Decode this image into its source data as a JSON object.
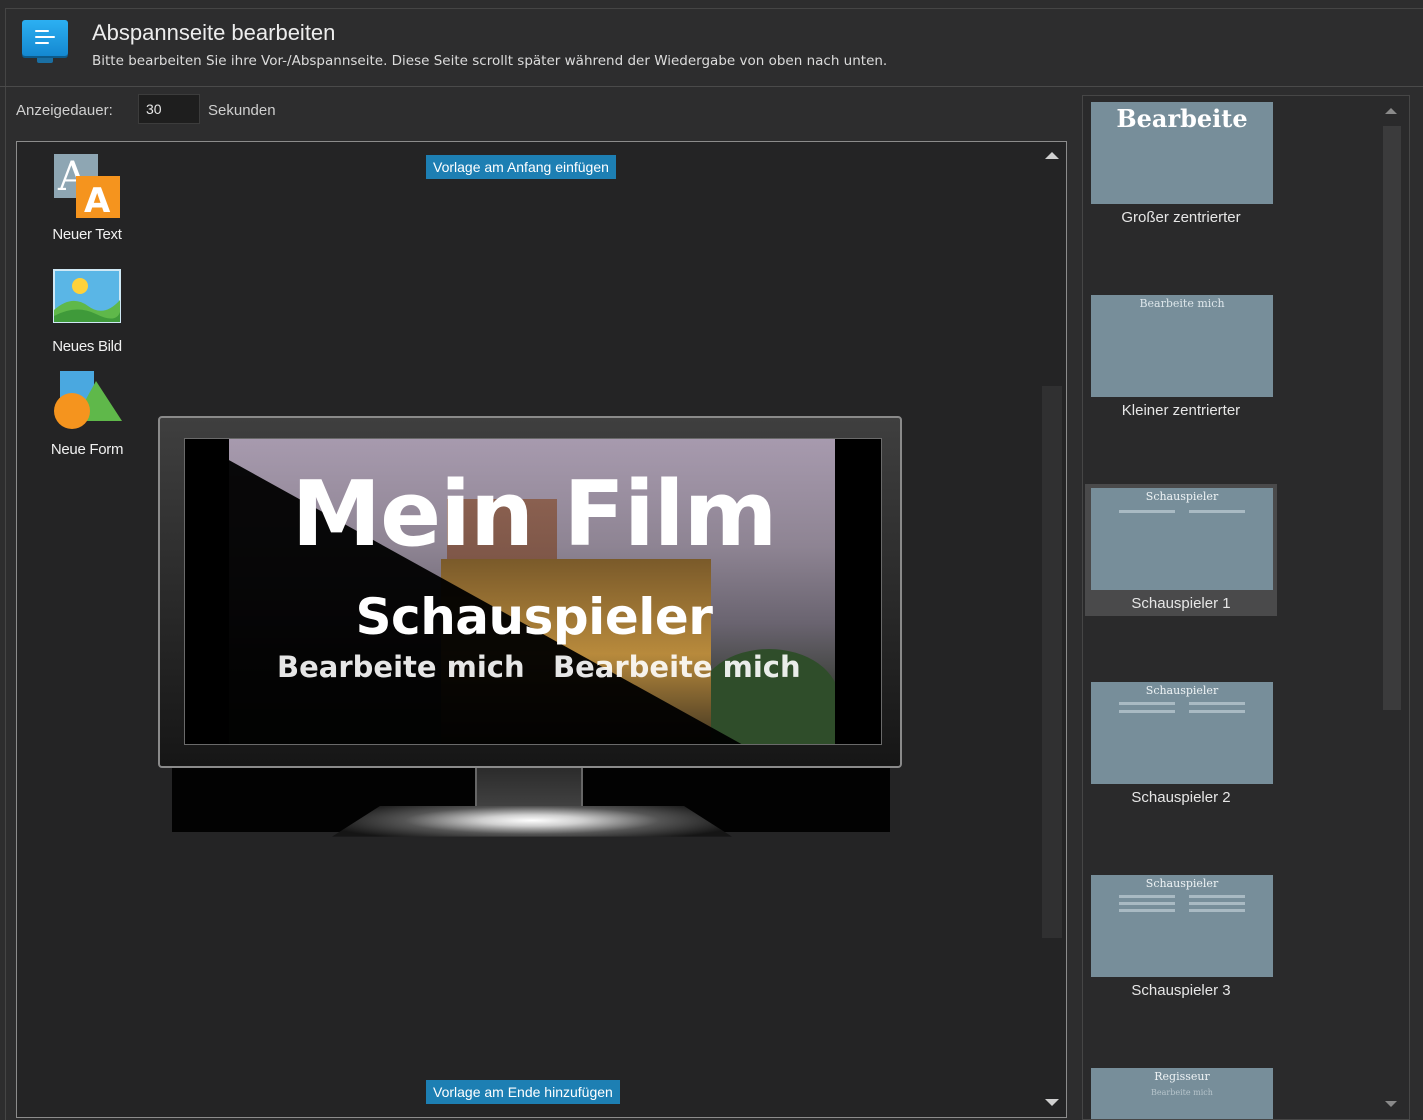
{
  "header": {
    "title": "Abspannseite bearbeiten",
    "subtitle": "Bitte bearbeiten Sie ihre Vor-/Abspannseite. Diese Seite scrollt später während der Wiedergabe von oben nach unten.",
    "icon": "list-monitor-icon"
  },
  "duration": {
    "label": "Anzeigedauer:",
    "value": "30",
    "unit": "Sekunden"
  },
  "editor": {
    "insert_top_label": "Vorlage am Anfang einfügen",
    "insert_bottom_label": "Vorlage am Ende hinzufügen",
    "tools": [
      {
        "label": "Neuer Text",
        "icon": "text-icon"
      },
      {
        "label": "Neues Bild",
        "icon": "image-icon"
      },
      {
        "label": "Neue Form",
        "icon": "shape-icon"
      }
    ],
    "preview": {
      "title": "Mein Film",
      "subtitle": "Schauspieler",
      "edit_left": "Bearbeite mich",
      "edit_right": "Bearbeite mich"
    }
  },
  "templates": [
    {
      "caption": "Großer zentrierter",
      "thumb_text": "Bearbeite",
      "selected": false
    },
    {
      "caption": "Kleiner zentrierter",
      "thumb_text": "Bearbeite mich",
      "selected": false
    },
    {
      "caption": "Schauspieler 1",
      "thumb_text": "Schauspieler",
      "selected": true
    },
    {
      "caption": "Schauspieler 2",
      "thumb_text": "Schauspieler",
      "selected": false
    },
    {
      "caption": "Schauspieler 3",
      "thumb_text": "Schauspieler",
      "selected": false
    },
    {
      "caption": "",
      "thumb_text": "Regisseur",
      "thumb_sub": "Bearbeite mich",
      "selected": false
    }
  ],
  "colors": {
    "accent": "#1d7fb3",
    "background": "#2d2d2e",
    "thumb": "#778e9a"
  }
}
